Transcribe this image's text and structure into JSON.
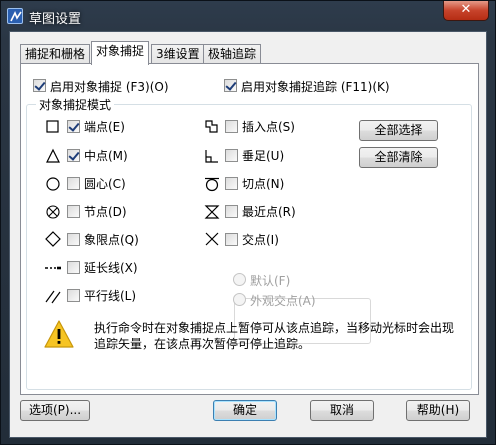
{
  "window": {
    "title": "草图设置",
    "close_label": "✕"
  },
  "tabs": [
    {
      "label": "捕捉和栅格",
      "active": false
    },
    {
      "label": "对象捕捉",
      "active": true
    },
    {
      "label": "3维设置",
      "active": false
    },
    {
      "label": "极轴追踪",
      "active": false
    }
  ],
  "top_options": {
    "osnap_on": {
      "label": "启用对象捕捉 (F3)(O)",
      "checked": true
    },
    "tracking_on": {
      "label": "启用对象捕捉追踪 (F11)(K)",
      "checked": true
    }
  },
  "modes": {
    "group_title": "对象捕捉模式",
    "left": [
      {
        "label": "端点(E)",
        "checked": true,
        "icon": "endpoint-square-icon"
      },
      {
        "label": "中点(M)",
        "checked": true,
        "icon": "midpoint-triangle-icon"
      },
      {
        "label": "圆心(C)",
        "checked": false,
        "icon": "center-circle-icon"
      },
      {
        "label": "节点(D)",
        "checked": false,
        "icon": "node-circle-x-icon"
      },
      {
        "label": "象限点(Q)",
        "checked": false,
        "icon": "quadrant-diamond-icon"
      },
      {
        "label": "延长线(X)",
        "checked": false,
        "icon": "extension-dash-icon"
      },
      {
        "label": "平行线(L)",
        "checked": false,
        "icon": "parallel-lines-icon"
      }
    ],
    "right": [
      {
        "label": "插入点(S)",
        "checked": false,
        "icon": "insertion-icon"
      },
      {
        "label": "垂足(U)",
        "checked": false,
        "icon": "perpendicular-icon"
      },
      {
        "label": "切点(N)",
        "checked": false,
        "icon": "tangent-icon"
      },
      {
        "label": "最近点(R)",
        "checked": false,
        "icon": "nearest-hourglass-icon"
      },
      {
        "label": "交点(I)",
        "checked": false,
        "icon": "intersection-x-icon"
      }
    ],
    "select_all_label": "全部选择",
    "clear_all_label": "全部清除",
    "radio_default": "默认(F)",
    "radio_apparent": "外观交点(A)"
  },
  "message": "执行命令时在对象捕捉点上暂停可从该点追踪，当移动光标时会出现追踪矢量，在该点再次暂停可停止追踪。",
  "footer": {
    "options_label": "选项(P)...",
    "ok_label": "确定",
    "cancel_label": "取消",
    "help_label": "帮助(H)"
  }
}
